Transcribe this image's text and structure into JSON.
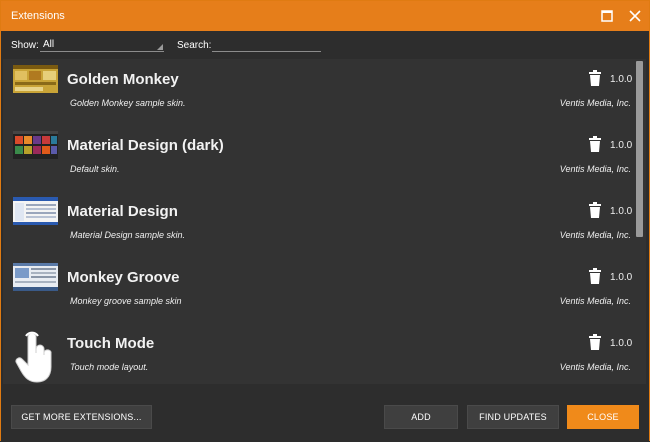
{
  "window": {
    "title": "Extensions"
  },
  "filter": {
    "show_label": "Show:",
    "show_value": "All",
    "search_label": "Search:",
    "search_value": "",
    "search_placeholder": ""
  },
  "extensions": [
    {
      "name": "Golden Monkey",
      "description": "Golden Monkey sample skin.",
      "version": "1.0.0",
      "author": "Ventis Media, Inc.",
      "thumb_icon": "golden-monkey-thumbnail"
    },
    {
      "name": "Material Design (dark)",
      "description": "Default skin.",
      "version": "1.0.0",
      "author": "Ventis Media, Inc.",
      "thumb_icon": "material-dark-thumbnail"
    },
    {
      "name": "Material Design",
      "description": "Material Design sample skin.",
      "version": "1.0.0",
      "author": "Ventis Media, Inc.",
      "thumb_icon": "material-design-thumbnail"
    },
    {
      "name": "Monkey Groove",
      "description": "Monkey groove sample skin",
      "version": "1.0.0",
      "author": "Ventis Media, Inc.",
      "thumb_icon": "monkey-groove-thumbnail"
    },
    {
      "name": "Touch Mode",
      "description": "Touch mode layout.",
      "version": "1.0.0",
      "author": "Ventis Media, Inc.",
      "thumb_icon": "hand-pointer-icon"
    }
  ],
  "buttons": {
    "get_more": "GET MORE EXTENSIONS...",
    "add": "ADD",
    "find_updates": "FIND UPDATES",
    "close": "CLOSE"
  },
  "colors": {
    "accent": "#e67e1a",
    "background": "#2d2d2d",
    "list_bg": "#333333"
  }
}
